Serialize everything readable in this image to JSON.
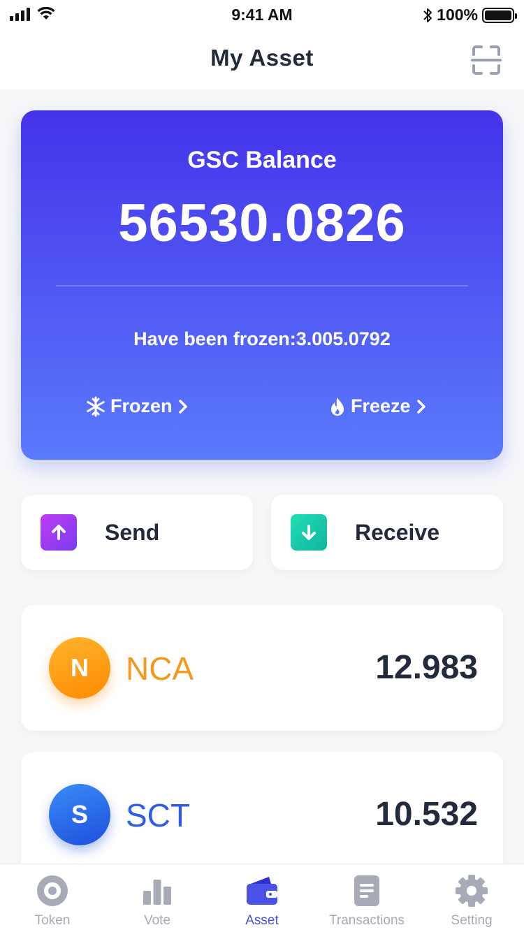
{
  "status_bar": {
    "time": "9:41 AM",
    "battery": "100%"
  },
  "header": {
    "title": "My Asset",
    "scan_icon": "scan-icon"
  },
  "balance_card": {
    "label": "GSC Balance",
    "value": "56530.0826",
    "frozen_text": "Have been frozen:3.005.0792",
    "actions": [
      {
        "label": "Frozen",
        "icon": "snowflake-icon"
      },
      {
        "label": "Freeze",
        "icon": "flame-icon"
      }
    ],
    "gradient": [
      "#4533ea",
      "#5a7afb"
    ]
  },
  "quick_actions": {
    "send": "Send",
    "receive": "Receive"
  },
  "tokens": [
    {
      "initial": "N",
      "name": "NCA",
      "value": "12.983",
      "color": "#f39a1e",
      "avatar_colors": [
        "#ffb52e",
        "#ff8a00"
      ]
    },
    {
      "initial": "S",
      "name": "SCT",
      "value": "10.532",
      "color": "#2e5ce6",
      "avatar_colors": [
        "#3a8cf7",
        "#1d4fdc"
      ]
    }
  ],
  "tab_bar": {
    "active": "Asset",
    "tabs": [
      {
        "label": "Token",
        "icon": "token-icon"
      },
      {
        "label": "Vote",
        "icon": "vote-chart-icon"
      },
      {
        "label": "Asset",
        "icon": "wallet-icon"
      },
      {
        "label": "Transactions",
        "icon": "document-icon"
      },
      {
        "label": "Setting",
        "icon": "gear-icon"
      }
    ],
    "active_color": "#4a52e8",
    "inactive_color": "#a7abb7"
  }
}
